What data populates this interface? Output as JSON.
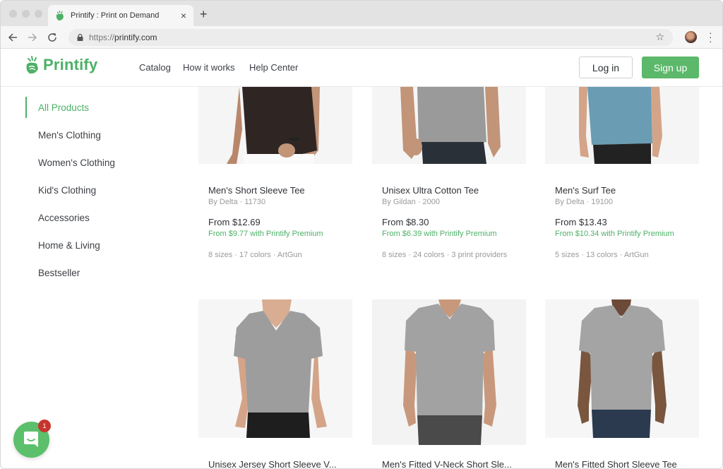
{
  "browser": {
    "tab_title": "Printify : Print on Demand",
    "new_tab_label": "+",
    "close_tab_label": "×",
    "url_scheme": "https://",
    "url_host": "printify.com",
    "icons": {
      "back": "arrow-left",
      "forward": "arrow-right",
      "reload": "reload",
      "lock": "lock",
      "bookmark": "star",
      "menu": "vertical-dots"
    }
  },
  "header": {
    "logo_text": "Printify",
    "nav": [
      "Catalog",
      "How it works",
      "Help Center"
    ],
    "login_label": "Log in",
    "signup_label": "Sign up",
    "brand_color": "#4db067"
  },
  "sidebar": {
    "items": [
      {
        "label": "All Products",
        "active": true
      },
      {
        "label": "Men's Clothing",
        "active": false
      },
      {
        "label": "Women's Clothing",
        "active": false
      },
      {
        "label": "Kid's Clothing",
        "active": false
      },
      {
        "label": "Accessories",
        "active": false
      },
      {
        "label": "Home & Living",
        "active": false
      },
      {
        "label": "Bestseller",
        "active": false
      }
    ]
  },
  "products": [
    {
      "name": "Men's Short Sleeve Tee",
      "brand": "By Delta · 11730",
      "price": "From $12.69",
      "premium": "From $9.77 with Printify Premium",
      "meta": "8 sizes · 17 colors · ArtGun",
      "shirt_color": "#2f2624"
    },
    {
      "name": "Unisex Ultra Cotton Tee",
      "brand": "By Gildan · 2000",
      "price": "From $8.30",
      "premium": "From $6.39 with Printify Premium",
      "meta": "8 sizes · 24 colors · 3 print providers",
      "shirt_color": "#9a9a9a"
    },
    {
      "name": "Men's Surf Tee",
      "brand": "By Delta · 19100",
      "price": "From $13.43",
      "premium": "From $10.34 with Printify Premium",
      "meta": "5 sizes · 13 colors · ArtGun",
      "shirt_color": "#6a9db3"
    },
    {
      "name": "Unisex Jersey Short Sleeve V...",
      "shirt_color": "#9d9d9d"
    },
    {
      "name": "Men's Fitted V-Neck Short Sle...",
      "shirt_color": "#a2a2a2"
    },
    {
      "name": "Men's Fitted Short Sleeve Tee",
      "shirt_color": "#a4a4a4"
    }
  ],
  "chat": {
    "badge_count": "1"
  }
}
